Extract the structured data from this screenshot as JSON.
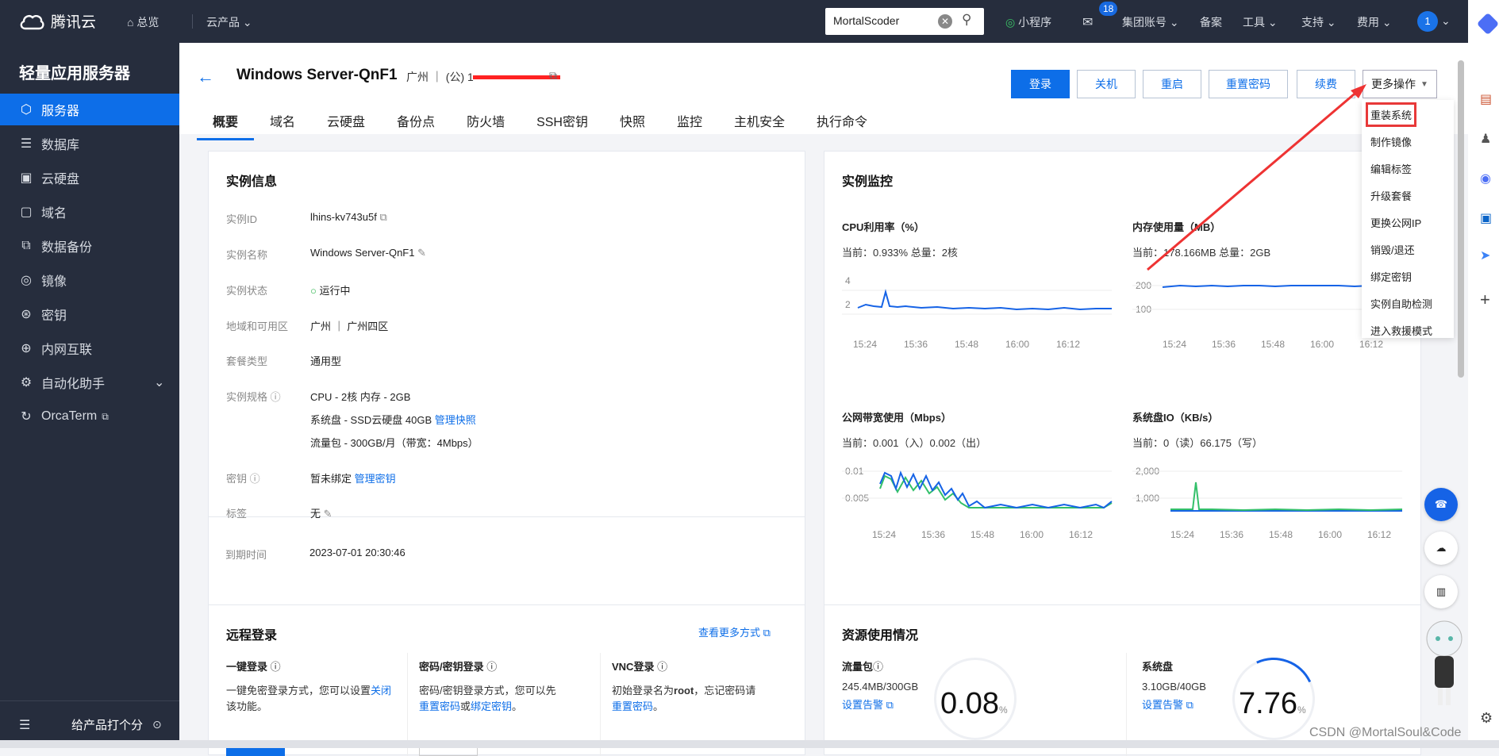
{
  "topbar": {
    "brand": "腾讯云",
    "nav": [
      "总览",
      "云产品"
    ],
    "search_value": "MortalScoder",
    "mini_program": "小程序",
    "mail_badge": "18",
    "account": "集团账号",
    "record": "备案",
    "tools": "工具",
    "support": "支持",
    "billing": "费用",
    "avatar": "1"
  },
  "sidebar": {
    "title": "轻量应用服务器",
    "items": [
      {
        "label": "服务器",
        "icon": "cube-icon"
      },
      {
        "label": "数据库",
        "icon": "database-icon"
      },
      {
        "label": "云硬盘",
        "icon": "disk-icon"
      },
      {
        "label": "域名",
        "icon": "domain-icon"
      },
      {
        "label": "数据备份",
        "icon": "backup-icon"
      },
      {
        "label": "镜像",
        "icon": "image-icon"
      },
      {
        "label": "密钥",
        "icon": "key-icon"
      },
      {
        "label": "内网互联",
        "icon": "network-icon"
      },
      {
        "label": "自动化助手",
        "icon": "automation-icon"
      },
      {
        "label": "OrcaTerm",
        "icon": "terminal-icon"
      }
    ],
    "footer_text": "给产品打个分"
  },
  "header": {
    "title": "Windows Server-QnF1",
    "region": "广州 ｜ (公) 1",
    "buttons": [
      "登录",
      "关机",
      "重启",
      "重置密码",
      "续费",
      "更多操作"
    ],
    "tabs": [
      "概要",
      "域名",
      "云硬盘",
      "备份点",
      "防火墙",
      "SSH密钥",
      "快照",
      "监控",
      "主机安全",
      "执行命令"
    ]
  },
  "instance_info": {
    "title": "实例信息",
    "rows": [
      {
        "label": "实例ID",
        "value": "lhins-kv743u5f"
      },
      {
        "label": "实例名称",
        "value": "Windows Server-QnF1"
      },
      {
        "label": "实例状态",
        "value": "运行中"
      },
      {
        "label": "地域和可用区",
        "value": "广州 ｜ 广州四区"
      },
      {
        "label": "套餐类型",
        "value": "通用型"
      },
      {
        "label": "实例规格",
        "value": "CPU - 2核 内存 - 2GB"
      },
      {
        "label": "",
        "value": "系统盘 - SSD云硬盘 40GB"
      },
      {
        "label": "",
        "value": "流量包 - 300GB/月（带宽：4Mbps）"
      },
      {
        "label": "密钥",
        "value": "暂未绑定"
      },
      {
        "label": "标签",
        "value": "无"
      },
      {
        "label": "到期时间",
        "value": "2023-07-01 20:30:46"
      }
    ],
    "manage_snapshot": "管理快照",
    "manage_key": "管理密钥"
  },
  "monitor": {
    "title": "实例监控",
    "charts": [
      {
        "title": "CPU利用率（%）",
        "sub": "当前：0.933% 总量：2核",
        "ticks_y": [
          "4",
          "2"
        ],
        "ticks_x": [
          "15:24",
          "15:36",
          "15:48",
          "16:00",
          "16:12"
        ]
      },
      {
        "title": "内存使用量（MB）",
        "sub": "当前：178.166MB 总量：2GB",
        "ticks_y": [
          "200",
          "100"
        ],
        "ticks_x": [
          "15:24",
          "15:36",
          "15:48",
          "16:00",
          "16:12"
        ]
      },
      {
        "title": "公网带宽使用（Mbps）",
        "sub": "当前：0.001（入）0.002（出）",
        "ticks_y": [
          "0.01",
          "0.005"
        ],
        "ticks_x": [
          "15:24",
          "15:36",
          "15:48",
          "16:00",
          "16:12"
        ]
      },
      {
        "title": "系统盘IO（KB/s）",
        "sub": "当前：0（读）66.175（写）",
        "ticks_y": [
          "2,000",
          "1,000"
        ],
        "ticks_x": [
          "15:24",
          "15:36",
          "15:48",
          "16:00",
          "16:12"
        ]
      }
    ]
  },
  "remote_login": {
    "title": "远程登录",
    "more_link": "查看更多方式",
    "cols": [
      {
        "title": "一键登录",
        "text": "一键免密登录方式，您可以设置",
        "link": "关闭",
        "text2": "该功能。"
      },
      {
        "title": "密码/密钥登录",
        "text": "密码/密钥登录方式，您可以先",
        "link": "重置密码",
        "mid": "或",
        "link2": "绑定密钥",
        "text2": "。"
      },
      {
        "title": "VNC登录",
        "text": "初始登录名为",
        "bold": "root",
        "text_b": "，忘记密码请",
        "link": "重置密码",
        "text2": "。"
      }
    ]
  },
  "resource": {
    "title": "资源使用情况",
    "traffic": {
      "label": "流量包",
      "value": "245.4MB/300GB",
      "alert": "设置告警",
      "percent": "0.08",
      "unit": "%"
    },
    "disk": {
      "label": "系统盘",
      "value": "3.10GB/40GB",
      "alert": "设置告警",
      "percent": "7.76",
      "unit": "%"
    }
  },
  "dropdown": {
    "items": [
      "重装系统",
      "制作镜像",
      "编辑标签",
      "升级套餐",
      "更换公网IP",
      "销毁/退还",
      "绑定密钥",
      "实例自助检测",
      "进入救援模式"
    ]
  },
  "watermark": "CSDN @MortalSoul&Code",
  "colors": {
    "primary": "#0d6ee8",
    "topbar": "#262d3d",
    "highlight": "#e83939"
  }
}
